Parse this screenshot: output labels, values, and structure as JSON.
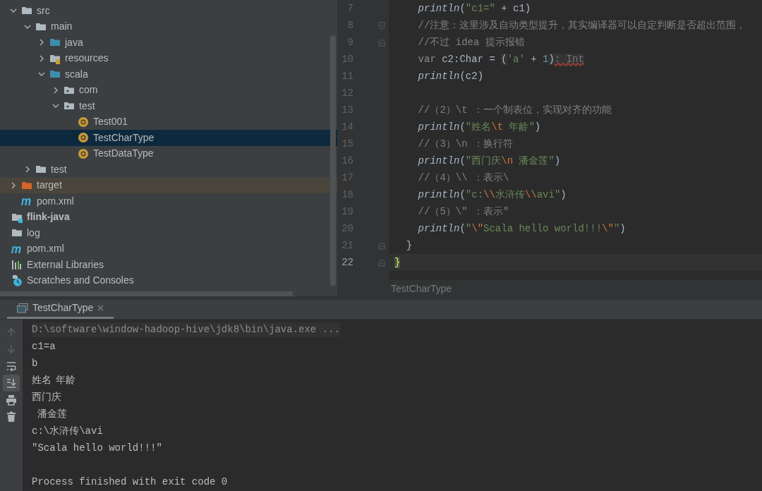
{
  "project_tree": {
    "module_children": [
      {
        "label": "src",
        "kind": "folder",
        "expanded": true,
        "selected": false,
        "children": [
          {
            "label": "main",
            "kind": "folder",
            "expanded": true,
            "selected": false,
            "children": [
              {
                "label": "java",
                "kind": "source-folder",
                "expanded": false,
                "selected": false
              },
              {
                "label": "resources",
                "kind": "resource-folder",
                "expanded": false,
                "selected": false
              },
              {
                "label": "scala",
                "kind": "source-folder",
                "expanded": true,
                "selected": false,
                "children": [
                  {
                    "label": "com",
                    "kind": "package",
                    "expanded": false,
                    "selected": false
                  },
                  {
                    "label": "test",
                    "kind": "package",
                    "expanded": true,
                    "selected": false,
                    "children": [
                      {
                        "label": "Test001",
                        "kind": "object",
                        "selected": false
                      },
                      {
                        "label": "TestCharType",
                        "kind": "object",
                        "selected": true
                      },
                      {
                        "label": "TestDataType",
                        "kind": "object",
                        "selected": false
                      }
                    ]
                  }
                ]
              }
            ]
          },
          {
            "label": "test",
            "kind": "folder",
            "expanded": false,
            "selected": false
          }
        ]
      },
      {
        "label": "target",
        "kind": "excluded-folder",
        "expanded": false,
        "selected": false
      },
      {
        "label": "pom.xml",
        "kind": "maven",
        "selected": false
      }
    ],
    "root_items": [
      {
        "label": "flink-java",
        "kind": "module",
        "bold": true,
        "selected": false
      },
      {
        "label": "log",
        "kind": "folder",
        "bold": false,
        "selected": false
      },
      {
        "label": "pom.xml",
        "kind": "maven",
        "bold": false,
        "selected": false
      },
      {
        "label": "External Libraries",
        "kind": "libraries",
        "bold": false,
        "selected": false
      },
      {
        "label": "Scratches and Consoles",
        "kind": "scratches",
        "bold": false,
        "selected": false
      }
    ]
  },
  "editor": {
    "lines": [
      {
        "number": "7",
        "current": false,
        "tokens": [
          {
            "kind": "fn",
            "text": "    println"
          },
          {
            "kind": "plain",
            "text": "("
          },
          {
            "kind": "string",
            "text": "\"c1=\""
          },
          {
            "kind": "plain",
            "text": " + c1)"
          }
        ]
      },
      {
        "number": "8",
        "fold_open": true,
        "current": false,
        "tokens": [
          {
            "kind": "comment",
            "text": "    //注意：这里涉及自动类型提升，其实编译器可以自定判断是否超出范围，"
          }
        ]
      },
      {
        "number": "9",
        "fold_close": true,
        "current": false,
        "tokens": [
          {
            "kind": "comment",
            "text": "    //不过 idea 提示报错"
          }
        ]
      },
      {
        "number": "10",
        "current": false,
        "tokens": [
          {
            "kind": "keyword",
            "text": "    var "
          },
          {
            "kind": "plain",
            "text": "c2:Char = "
          },
          {
            "kind": "hinted",
            "text": "("
          },
          {
            "kind": "string",
            "text": "'a'"
          },
          {
            "kind": "plain",
            "text": " + "
          },
          {
            "kind": "number",
            "text": "1"
          },
          {
            "kind": "hinted",
            "text": ")"
          },
          {
            "kind": "hint",
            "text": ": Int"
          }
        ]
      },
      {
        "number": "11",
        "current": false,
        "tokens": [
          {
            "kind": "fn",
            "text": "    println"
          },
          {
            "kind": "plain",
            "text": "(c2)"
          }
        ]
      },
      {
        "number": "12",
        "current": false
      },
      {
        "number": "13",
        "current": false,
        "tokens": [
          {
            "kind": "comment",
            "text": "    //（2）\\t ：一个制表位，实现对齐的功能"
          }
        ]
      },
      {
        "number": "14",
        "current": false,
        "tokens": [
          {
            "kind": "fn",
            "text": "    println"
          },
          {
            "kind": "plain",
            "text": "("
          },
          {
            "kind": "string",
            "text": "\"姓名"
          },
          {
            "kind": "escape",
            "text": "\\t"
          },
          {
            "kind": "string",
            "text": " 年龄\""
          },
          {
            "kind": "plain",
            "text": ")"
          }
        ]
      },
      {
        "number": "15",
        "current": false,
        "tokens": [
          {
            "kind": "comment",
            "text": "    //（3）\\n ：换行符"
          }
        ]
      },
      {
        "number": "16",
        "current": false,
        "tokens": [
          {
            "kind": "fn",
            "text": "    println"
          },
          {
            "kind": "plain",
            "text": "("
          },
          {
            "kind": "string",
            "text": "\"西门庆"
          },
          {
            "kind": "escape",
            "text": "\\n"
          },
          {
            "kind": "string",
            "text": " 潘金莲\""
          },
          {
            "kind": "plain",
            "text": ")"
          }
        ]
      },
      {
        "number": "17",
        "current": false,
        "tokens": [
          {
            "kind": "comment",
            "text": "    //（4）\\\\ ：表示\\"
          }
        ]
      },
      {
        "number": "18",
        "current": false,
        "tokens": [
          {
            "kind": "fn",
            "text": "    println"
          },
          {
            "kind": "plain",
            "text": "("
          },
          {
            "kind": "string",
            "text": "\"c:"
          },
          {
            "kind": "escape",
            "text": "\\\\"
          },
          {
            "kind": "string",
            "text": "水浒传"
          },
          {
            "kind": "escape",
            "text": "\\\\"
          },
          {
            "kind": "string",
            "text": "avi\""
          },
          {
            "kind": "plain",
            "text": ")"
          }
        ]
      },
      {
        "number": "19",
        "current": false,
        "tokens": [
          {
            "kind": "comment",
            "text": "    //（5）\\\" ：表示\""
          }
        ]
      },
      {
        "number": "20",
        "current": false,
        "tokens": [
          {
            "kind": "fn",
            "text": "    println"
          },
          {
            "kind": "plain",
            "text": "("
          },
          {
            "kind": "string",
            "text": "\""
          },
          {
            "kind": "escape",
            "text": "\\\""
          },
          {
            "kind": "string",
            "text": "Scala hello world!!!"
          },
          {
            "kind": "escape",
            "text": "\\\""
          },
          {
            "kind": "string",
            "text": "\""
          },
          {
            "kind": "plain",
            "text": ")"
          }
        ]
      },
      {
        "number": "21",
        "fold_close": true,
        "current": false,
        "tokens": [
          {
            "kind": "plain",
            "text": "  }"
          }
        ]
      },
      {
        "number": "22",
        "fold_close": true,
        "current": true,
        "tokens": [
          {
            "kind": "brace-match",
            "text": "}"
          }
        ]
      }
    ],
    "breadcrumb": "TestCharType"
  },
  "run_panel": {
    "tab": {
      "label": "TestCharType",
      "selected": true
    },
    "tools": [
      {
        "kind": "up",
        "disabled": true,
        "selected": false
      },
      {
        "kind": "down",
        "disabled": true,
        "selected": false
      },
      {
        "kind": "wrap",
        "disabled": false,
        "selected": false
      },
      {
        "kind": "scroll-end",
        "disabled": false,
        "selected": true
      },
      {
        "kind": "print",
        "disabled": false,
        "selected": false
      },
      {
        "kind": "trash",
        "disabled": false,
        "selected": false
      }
    ],
    "output": [
      {
        "kind": "command",
        "text": "D:\\software\\window-hadoop-hive\\jdk8\\bin\\java.exe ..."
      },
      {
        "kind": "stdout",
        "text": "c1=a"
      },
      {
        "kind": "stdout",
        "text": "b"
      },
      {
        "kind": "stdout",
        "text": "姓名\t年龄"
      },
      {
        "kind": "stdout",
        "text": "西门庆"
      },
      {
        "kind": "stdout",
        "text": " 潘金莲"
      },
      {
        "kind": "stdout",
        "text": "c:\\水浒传\\avi"
      },
      {
        "kind": "stdout",
        "text": "\"Scala hello world!!!\""
      },
      {
        "kind": "system",
        "text": "Process finished with exit code 0"
      }
    ]
  }
}
